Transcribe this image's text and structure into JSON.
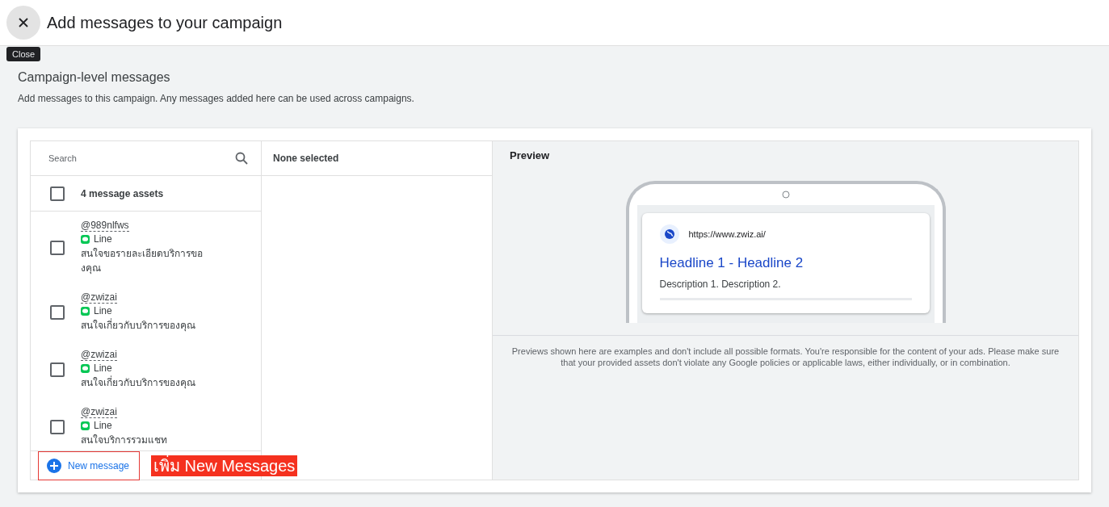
{
  "header": {
    "title": "Add messages to your campaign",
    "tooltip": "Close"
  },
  "section": {
    "title": "Campaign-level messages",
    "description": "Add messages to this campaign. Any messages added here can be used across campaigns."
  },
  "search": {
    "placeholder": "Search"
  },
  "select_all": {
    "label": "4 message assets",
    "checked": false
  },
  "messages": [
    {
      "handle": "@989nlfws",
      "channel": "Line",
      "text": "สนใจขอรายละเอียดบริการขอ\nงคุณ",
      "checked": false
    },
    {
      "handle": "@zwizai",
      "channel": "Line",
      "text": "สนใจเกี่ยวกับบริการของคุณ",
      "checked": false
    },
    {
      "handle": "@zwizai",
      "channel": "Line",
      "text": "สนใจเกี่ยวกับบริการของคุณ",
      "checked": false
    },
    {
      "handle": "@zwizai",
      "channel": "Line",
      "text": "สนใจบริการรวมแชท",
      "checked": false
    }
  ],
  "new_message_button": "New message",
  "annotation": "เพิ่ม New Messages",
  "selected_panel": {
    "title": "None selected"
  },
  "preview": {
    "title": "Preview",
    "url": "https://www.zwiz.ai/",
    "headline": "Headline 1 - Headline 2",
    "description": "Description 1. Description 2.",
    "disclaimer": "Previews shown here are examples and don't include all possible formats. You're responsible for the content of your ads. Please make sure that your provided assets don't violate any Google policies or applicable laws, either individually, or in combination."
  }
}
